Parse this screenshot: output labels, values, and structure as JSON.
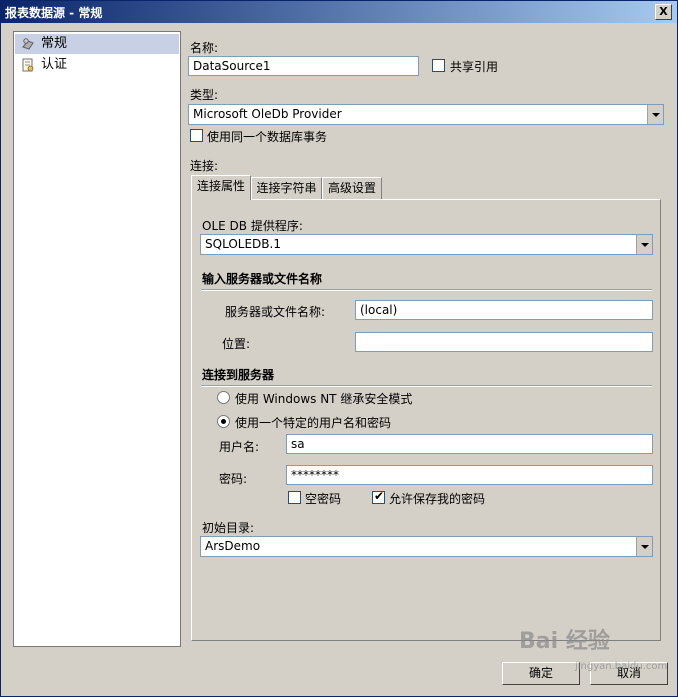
{
  "window": {
    "title": "报表数据源 - 常规",
    "close_glyph": "X"
  },
  "nav": {
    "items": [
      {
        "label": "常规",
        "icon": "gear-icon"
      },
      {
        "label": "认证",
        "icon": "document-icon"
      }
    ]
  },
  "form": {
    "name_label": "名称:",
    "name_value": "DataSource1",
    "shared_reference_label": "共享引用",
    "type_label": "类型:",
    "type_value": "Microsoft OleDb Provider",
    "same_transaction_label": "使用同一个数据库事务",
    "connection_label": "连接:"
  },
  "tabs": [
    "连接属性",
    "连接字符串",
    "高级设置"
  ],
  "connection": {
    "provider_label": "OLE DB 提供程序:",
    "provider_value": "SQLOLEDB.1",
    "server_section": "输入服务器或文件名称",
    "server_label": "服务器或文件名称:",
    "server_value": "(local)",
    "location_label": "位置:",
    "location_value": "",
    "connect_section": "连接到服务器",
    "auth_windows_label": "使用 Windows NT 继承安全模式",
    "auth_user_label": "使用一个特定的用户名和密码",
    "username_label": "用户名:",
    "username_value": "sa",
    "password_label": "密码:",
    "password_value": "********",
    "blank_password_label": "空密码",
    "save_password_label": "允许保存我的密码",
    "save_password_checked": true,
    "initial_catalog_label": "初始目录:",
    "initial_catalog_value": "ArsDemo"
  },
  "buttons": {
    "ok": "确定",
    "cancel": "取消"
  },
  "watermark": {
    "text": "Bai 经验",
    "sub": "jingyan.baidu.com"
  }
}
